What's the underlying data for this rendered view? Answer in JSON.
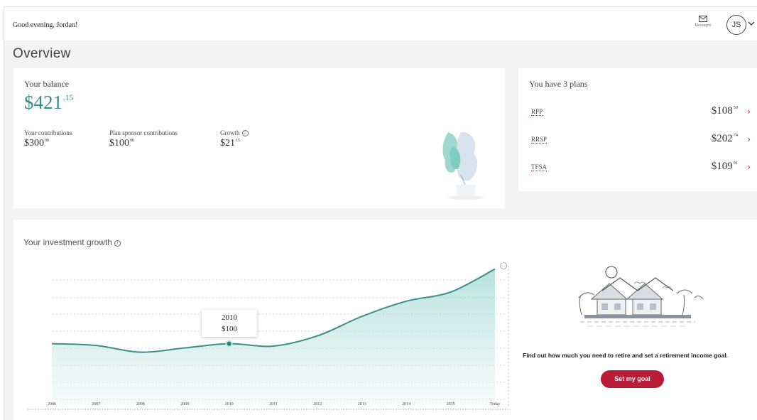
{
  "header": {
    "greeting": "Good evening, Jordan!",
    "messages_label": "Messages",
    "avatar_initials": "JS"
  },
  "page_title": "Overview",
  "balance": {
    "label": "Your balance",
    "amount_main": "$421",
    "amount_cents": ".15",
    "contributions": [
      {
        "label": "Your contributions",
        "main": "$300",
        "cents": "00"
      },
      {
        "label": "Plan sponsor contributions",
        "main": "$100",
        "cents": "00"
      },
      {
        "label": "Growth",
        "main": "$21",
        "cents": "15"
      }
    ]
  },
  "plans": {
    "title": "You have 3 plans",
    "items": [
      {
        "name": "RPP",
        "main": "$108",
        "cents": "50"
      },
      {
        "name": "RRSP",
        "main": "$202",
        "cents": "74"
      },
      {
        "name": "TFSA",
        "main": "$109",
        "cents": "91"
      }
    ]
  },
  "growth": {
    "title": "Your investment growth",
    "tooltip_year": "2010",
    "tooltip_value": "$100",
    "goal_text": "Find out how much you need to retire and set a retirement income goal.",
    "goal_button": "Set my goal"
  },
  "chart_data": {
    "type": "area",
    "x": [
      "2006",
      "2007",
      "2008",
      "2009",
      "2010",
      "2011",
      "2012",
      "2013",
      "2014",
      "2015",
      "Today"
    ],
    "values": [
      100,
      97,
      86,
      93,
      100,
      96,
      113,
      145,
      170,
      185,
      223
    ],
    "highlight": {
      "x": "2010",
      "value": 100
    },
    "color": "#3a8f8a"
  },
  "colors": {
    "accent_teal": "#3a8a8a",
    "brand_red": "#b91c36"
  }
}
